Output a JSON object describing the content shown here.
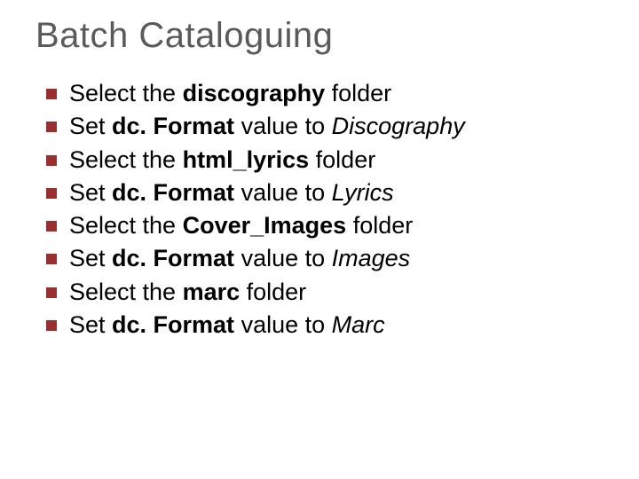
{
  "title": "Batch Cataloguing",
  "items": [
    {
      "pre": "Select the ",
      "bold": "discography",
      "mid": " folder",
      "italic": ""
    },
    {
      "pre": "Set ",
      "bold": "dc. Format",
      "mid": " value to ",
      "italic": "Discography"
    },
    {
      "pre": "Select the ",
      "bold": "html_lyrics",
      "mid": " folder",
      "italic": ""
    },
    {
      "pre": "Set ",
      "bold": "dc. Format",
      "mid": " value  to ",
      "italic": "Lyrics"
    },
    {
      "pre": "Select the ",
      "bold": "Cover_Images",
      "mid": " folder",
      "italic": ""
    },
    {
      "pre": "Set ",
      "bold": "dc. Format",
      "mid": " value  to ",
      "italic": "Images"
    },
    {
      "pre": "Select the ",
      "bold": "marc",
      "mid": " folder",
      "italic": ""
    },
    {
      "pre": "Set ",
      "bold": "dc. Format",
      "mid": " value  to ",
      "italic": "Marc"
    }
  ]
}
